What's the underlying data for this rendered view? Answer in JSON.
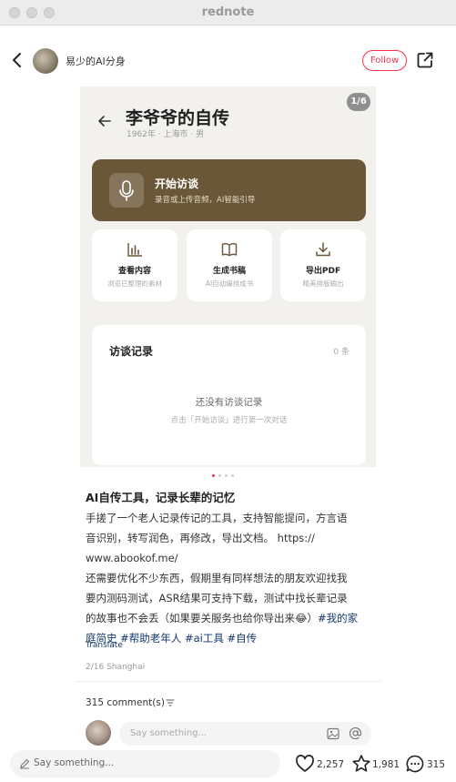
{
  "window": {
    "title": "rednote"
  },
  "header": {
    "author_name": "易少的AI分身",
    "follow_label": "Follow"
  },
  "post_image": {
    "page_indicator": "1/6",
    "app_title": "李爷爷的自传",
    "app_subtitle": "1962年 · 上海市 · 男",
    "start_card": {
      "title": "开始访谈",
      "desc": "录音或上传音频，AI智能引导"
    },
    "actions": [
      {
        "title": "查看内容",
        "desc": "浏览已整理的素材",
        "icon": "bar-chart-icon"
      },
      {
        "title": "生成书稿",
        "desc": "AI自动编排成书",
        "icon": "book-icon"
      },
      {
        "title": "导出PDF",
        "desc": "精美排版输出",
        "icon": "download-icon"
      }
    ],
    "records": {
      "title": "访谈记录",
      "count": "0 条",
      "empty_title": "还没有访谈记录",
      "empty_desc": "点击「开始访谈」进行第一次对话"
    },
    "accent_color": "#6a5738",
    "carousel_total": 4,
    "carousel_active": 1
  },
  "post": {
    "title": "AI自传工具，记录长辈的记忆",
    "body_lines": [
      "手搓了一个老人记录传记的工具，支持智能提问，方言语",
      "音识别，转写润色，再修改，导出文档。 https://",
      "www.abookof.me/",
      "还需要优化不少东西，假期里有同样想法的朋友欢迎找我",
      "要内测码测试，ASR结果可支持下载，测试中找长辈记录",
      "的故事也不会丢（如果要关服务也给你导出来😂）"
    ],
    "hashtag_1": "#我的家",
    "hashtag_1b": "庭简史",
    "hashtag_2": "#帮助老年人",
    "hashtag_3": "#ai工具",
    "hashtag_4": "#自传",
    "translate_label": "Translate",
    "meta": "2/16 Shanghai"
  },
  "comments": {
    "count_label": "315 comment(s)",
    "input_placeholder": "Say something..."
  },
  "bottom_bar": {
    "input_placeholder": "Say something...",
    "likes": "2,257",
    "favorites": "1,981",
    "comments": "315"
  }
}
